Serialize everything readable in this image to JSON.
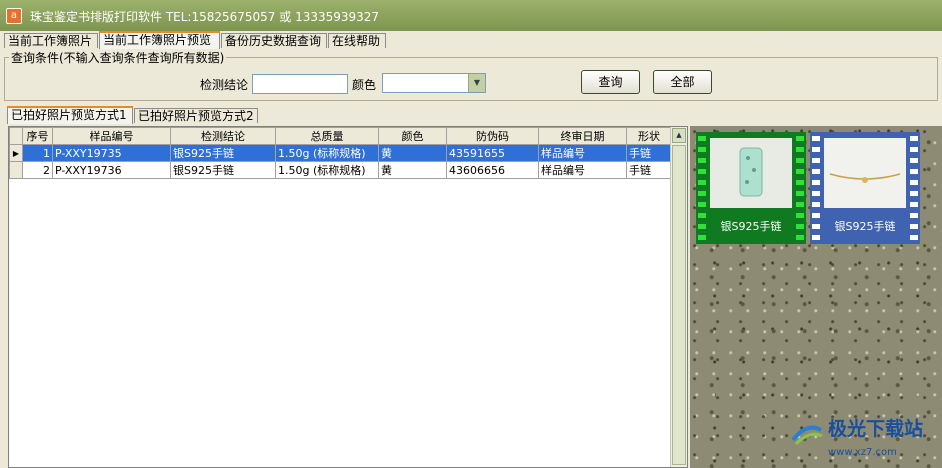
{
  "window": {
    "title": "珠宝鉴定书排版打印软件 TEL:15825675057 或 13335939327",
    "app_icon_glyph": "a"
  },
  "main_tabs": [
    {
      "label": "当前工作簿照片",
      "active": false
    },
    {
      "label": "当前工作簿照片预览",
      "active": true
    },
    {
      "label": "备份历史数据查询",
      "active": false
    },
    {
      "label": "在线帮助",
      "active": false
    }
  ],
  "query": {
    "group_title": "查询条件(不输入查询条件查询所有数据)",
    "conclusion_label": "检测结论",
    "conclusion_value": "",
    "color_label": "颜色",
    "color_value": "",
    "search_button": "查询",
    "all_button": "全部"
  },
  "sub_tabs": [
    {
      "label": "已拍好照片预览方式1",
      "active": true
    },
    {
      "label": "已拍好照片预览方式2",
      "active": false
    }
  ],
  "table": {
    "columns": [
      "序号",
      "样品编号",
      "检测结论",
      "总质量",
      "颜色",
      "防伪码",
      "终审日期",
      "形状"
    ],
    "rows": [
      {
        "selected": true,
        "cells": [
          "1",
          "P-XXY19735",
          "银S925手链",
          "1.50g (标称规格)",
          "黄",
          "43591655",
          "样品编号",
          "手链"
        ]
      },
      {
        "selected": false,
        "cells": [
          "2",
          "P-XXY19736",
          "银S925手链",
          "1.50g (标称规格)",
          "黄",
          "43606656",
          "样品编号",
          "手链"
        ]
      }
    ],
    "current_row_marker": "▶"
  },
  "photos": [
    {
      "caption": "银S925手链",
      "frame_color": "#0f7a1f",
      "hole_color": "#2fe23a"
    },
    {
      "caption": "银S925手链",
      "frame_color": "#3f63b0",
      "hole_color": "#ffffff"
    }
  ],
  "watermark": {
    "text": "极光下载站",
    "sub": "www.xz7.com"
  },
  "colors": {
    "title_bar": "#8ea45f",
    "selection": "#2f6fd6",
    "active_tab_accent": "#e68b2c"
  }
}
